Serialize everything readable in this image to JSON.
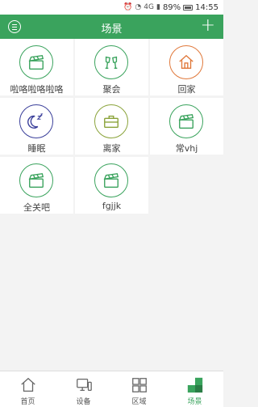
{
  "status": {
    "signal": "4G",
    "battery": "89%",
    "time": "14:55"
  },
  "header": {
    "title": "场景",
    "add_label": "+"
  },
  "scenes": [
    {
      "label": "啦咯啦咯啦咯",
      "icon": "clapperboard-icon",
      "color": "#3aa35d"
    },
    {
      "label": "聚会",
      "icon": "cheers-glasses-icon",
      "color": "#3aa35d"
    },
    {
      "label": "回家",
      "icon": "home-icon",
      "color": "#e0783a"
    },
    {
      "label": "睡眠",
      "icon": "moon-sleep-icon",
      "color": "#3a3f9a"
    },
    {
      "label": "离家",
      "icon": "briefcase-icon",
      "color": "#8aa33a"
    },
    {
      "label": "常vhj",
      "icon": "clapperboard-icon",
      "color": "#3aa35d"
    },
    {
      "label": "全关吧",
      "icon": "clapperboard-icon",
      "color": "#3aa35d"
    },
    {
      "label": "fgjjk",
      "icon": "clapperboard-icon",
      "color": "#3aa35d"
    }
  ],
  "tabs": [
    {
      "label": "首页",
      "icon": "home-tab-icon",
      "active": false
    },
    {
      "label": "设备",
      "icon": "device-tab-icon",
      "active": false
    },
    {
      "label": "区域",
      "icon": "area-tab-icon",
      "active": false
    },
    {
      "label": "场景",
      "icon": "scene-tab-icon",
      "active": true
    }
  ],
  "colors": {
    "accent": "#3aa35d",
    "background": "#f3f3f3"
  }
}
